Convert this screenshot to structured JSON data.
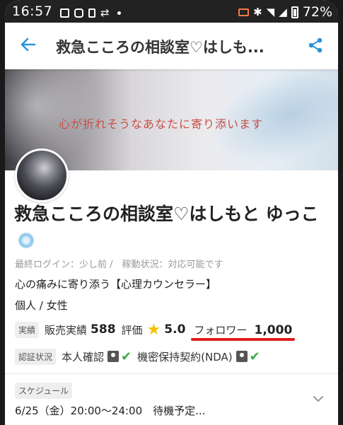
{
  "status_bar": {
    "time": "16:57",
    "battery": "72%"
  },
  "app_bar": {
    "title": "救急こころの相談室♡はしも..."
  },
  "banner": {
    "text": "心が折れそうなあなたに寄り添います"
  },
  "profile": {
    "name": "救急こころの相談室♡はしもと ゆっこ",
    "last_login": "最終ログイン：少し前 /　稼動状況：対応可能です",
    "catchphrase": "心の痛みに寄り添う【心理カウンセラー】",
    "type_gender": "個人 / 女性"
  },
  "stats": {
    "tag": "実績",
    "sales_label": "販売実績",
    "sales_value": "588",
    "rating_label": "評価",
    "rating_value": "5.0",
    "follower_label": "フォロワー",
    "follower_value": "1,000"
  },
  "verification": {
    "tag": "認証状況",
    "identity_label": "本人確認",
    "nda_label": "機密保持契約(NDA)"
  },
  "schedule": {
    "tag": "スケジュール",
    "text": "6/25（金）20:00～24:00　待機予定..."
  },
  "colors": {
    "accent_blue": "#2a94d6",
    "star": "#f6c300",
    "check_green": "#3cab49",
    "underline_red": "#e21b1b"
  }
}
